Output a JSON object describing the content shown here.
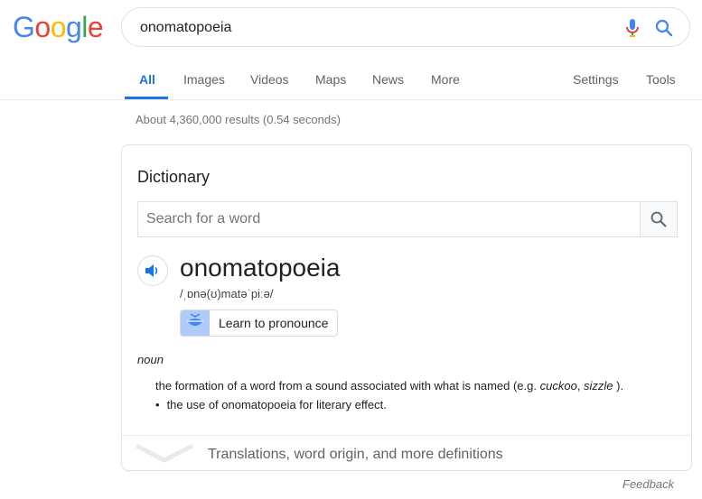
{
  "logo": {
    "letters": [
      "G",
      "o",
      "o",
      "g",
      "l",
      "e"
    ],
    "colors": [
      "#4285F4",
      "#EA4335",
      "#FBBC05",
      "#4285F4",
      "#34A853",
      "#EA4335"
    ]
  },
  "search": {
    "query": "onomatopoeia",
    "mic_icon": "mic-icon",
    "search_icon": "search-icon"
  },
  "tabs": {
    "all": "All",
    "images": "Images",
    "videos": "Videos",
    "maps": "Maps",
    "news": "News",
    "more": "More",
    "settings": "Settings",
    "tools": "Tools"
  },
  "stats": "About 4,360,000 results (0.54 seconds)",
  "dictionary": {
    "title": "Dictionary",
    "search_placeholder": "Search for a word",
    "word": "onomatopoeia",
    "phonetic": "/ˌɒnə(ʊ)matəˈpiːə/",
    "learn_button": "Learn to pronounce",
    "part_of_speech": "noun",
    "definition_prefix": "the formation of a word from a sound associated with what is named (e.g. ",
    "example_1": "cuckoo",
    "example_sep": ", ",
    "example_2": "sizzle",
    "definition_suffix": " ).",
    "subdefinition": "the use of onomatopoeia for literary effect.",
    "bullet": "•",
    "more_link": "Translations, word origin, and more definitions"
  },
  "feedback": "Feedback",
  "colors": {
    "accent": "#1a73e8",
    "muted": "#70757a",
    "border": "#dfe1e5"
  }
}
